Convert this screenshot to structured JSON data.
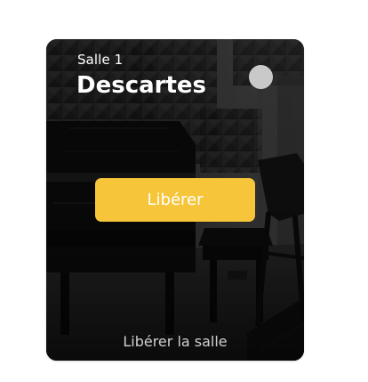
{
  "room": {
    "subtitle": "Salle 1",
    "name": "Descartes"
  },
  "actions": {
    "release_button_label": "Libérer",
    "release_room_link_label": "Libérer la salle"
  },
  "colors": {
    "accent_button": "#f6c53a",
    "status_dot": "#c9c9c9"
  }
}
